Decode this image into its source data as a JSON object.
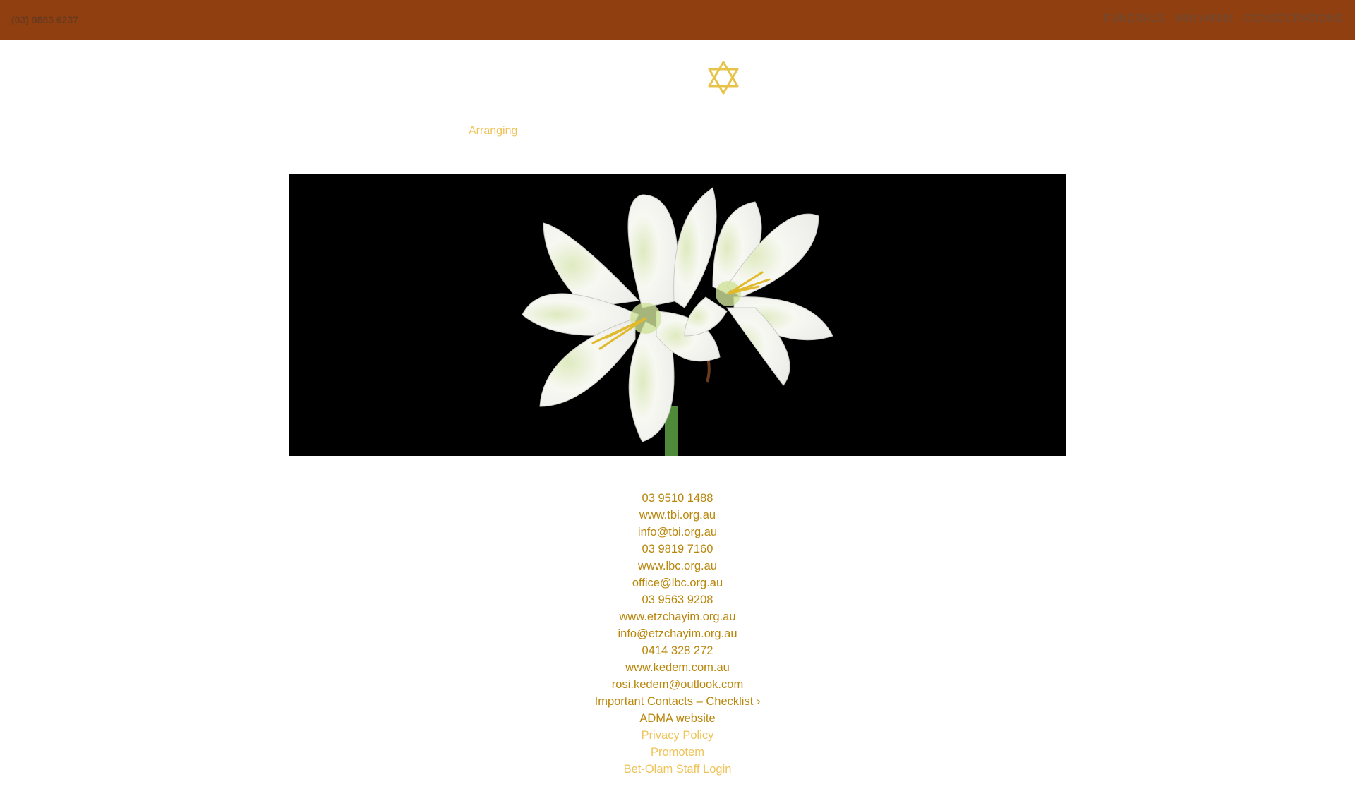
{
  "header": {
    "phone": "(03) 9883 6237",
    "nav": [
      "FUNERALS",
      "MINYANIM",
      "CONSECRATIONS"
    ]
  },
  "logo": {
    "icon": "star-of-david-icon",
    "color": "#e8c34a"
  },
  "main": {
    "link": "Arranging",
    "hero_image": "white-lily-flowers-on-black"
  },
  "footer": {
    "contacts": [
      "03 9510 1488",
      "www.tbi.org.au",
      "info@tbi.org.au",
      "03 9819 7160",
      "www.lbc.org.au",
      "office@lbc.org.au",
      "03 9563 9208",
      "www.etzchayim.org.au",
      "info@etzchayim.org.au",
      "0414 328 272",
      "www.kedem.com.au",
      "rosi.kedem@outlook.com",
      "Important Contacts – Checklist ›",
      "ADMA website"
    ],
    "links": [
      "Privacy Policy",
      "Promotem",
      "Bet-Olam Staff Login"
    ]
  },
  "colors": {
    "topbar": "#8f3f10",
    "link_dark": "#b8860b",
    "link_light": "#f0c358"
  }
}
